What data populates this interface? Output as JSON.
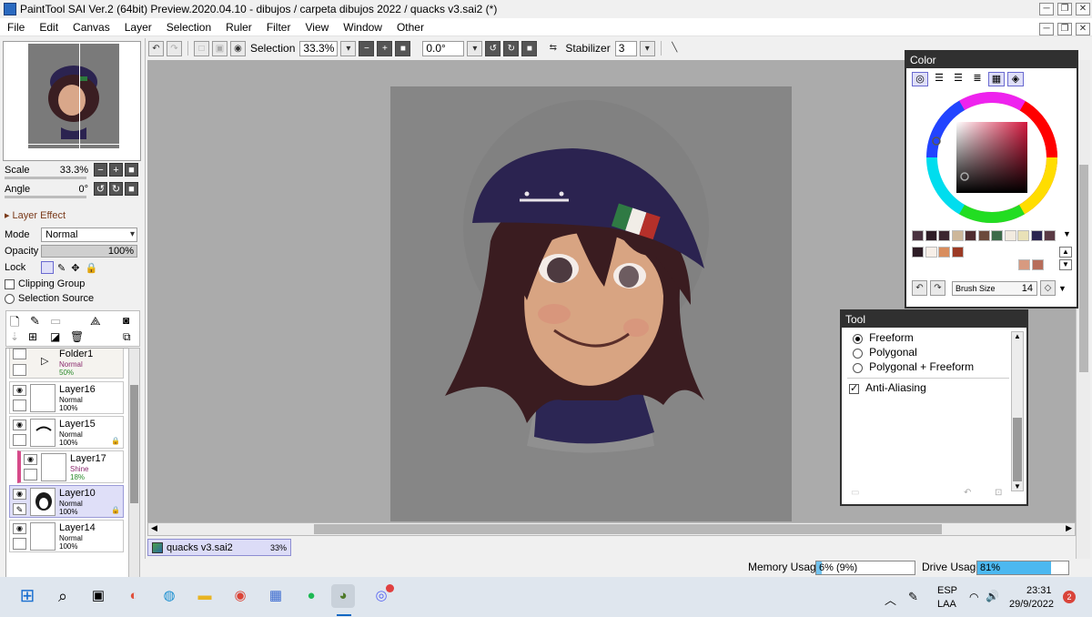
{
  "window": {
    "title": "PaintTool SAI Ver.2 (64bit) Preview.2020.04.10 - dibujos / carpeta dibujos 2022 / quacks v3.sai2 (*)",
    "buttons": [
      "─",
      "❐",
      "✕"
    ],
    "inner_buttons": [
      "─",
      "❐",
      "✕"
    ]
  },
  "menu": [
    "File",
    "Edit",
    "Canvas",
    "Layer",
    "Selection",
    "Ruler",
    "Filter",
    "View",
    "Window",
    "Other"
  ],
  "toolbar": {
    "selection_label": "Selection",
    "zoom_value": "33.3%",
    "angle_value": "0.0°",
    "stabilizer_label": "Stabilizer",
    "stabilizer_value": "3"
  },
  "navigator": {
    "scale_label": "Scale",
    "scale_value": "33.3%",
    "angle_label": "Angle",
    "angle_value": "0°"
  },
  "layer_props": {
    "layer_effect_label": "Layer Effect",
    "mode_label": "Mode",
    "mode_value": "Normal",
    "opacity_label": "Opacity",
    "opacity_value": "100%",
    "lock_label": "Lock",
    "clipping_group_label": "Clipping Group",
    "selection_source_label": "Selection Source"
  },
  "layers": [
    {
      "name": "Folder1",
      "mode": "Normal",
      "opacity": "50%"
    },
    {
      "name": "Layer16",
      "mode": "Normal",
      "opacity": "100%"
    },
    {
      "name": "Layer15",
      "mode": "Normal",
      "opacity": "100%"
    },
    {
      "name": "Layer17",
      "mode": "Shine",
      "opacity": "18%"
    },
    {
      "name": "Layer10",
      "mode": "Normal",
      "opacity": "100%"
    },
    {
      "name": "Layer14",
      "mode": "Normal",
      "opacity": "100%"
    }
  ],
  "document_tab": {
    "name": "quacks v3.sai2",
    "zoom": "33%"
  },
  "status": {
    "memory_label": "Memory Usage",
    "memory_value": "6% (9%)",
    "memory_fill": 0.06,
    "drive_label": "Drive Usage",
    "drive_value": "81%",
    "drive_fill": 0.81
  },
  "color_panel": {
    "title": "Color",
    "brush_size_label": "Brush Size",
    "brush_size_value": "14",
    "swatches_row1": [
      "#4a3340",
      "#2e1d26",
      "#3c2730",
      "#cdb79a",
      "#4f2c2f",
      "#6b4a3c",
      "#3d6b4a",
      "#f2ebe0",
      "#e9e1b7",
      "#2a2550",
      "#5a3a44"
    ],
    "swatches_row2": [
      "#2e1d26",
      "#f7efe8",
      "#d88d5e",
      "#9b3a25"
    ],
    "swatches_row3": [
      "#d79a80",
      "#b76d5a"
    ]
  },
  "tool_panel": {
    "title": "Tool",
    "options": [
      "Freeform",
      "Polygonal",
      "Polygonal + Freeform"
    ],
    "selected": "Freeform",
    "anti_aliasing_label": "Anti-Aliasing"
  },
  "taskbar": {
    "lang_top": "ESP",
    "lang_bottom": "LAA",
    "time": "23:31",
    "date": "29/9/2022",
    "notifications": "2"
  }
}
